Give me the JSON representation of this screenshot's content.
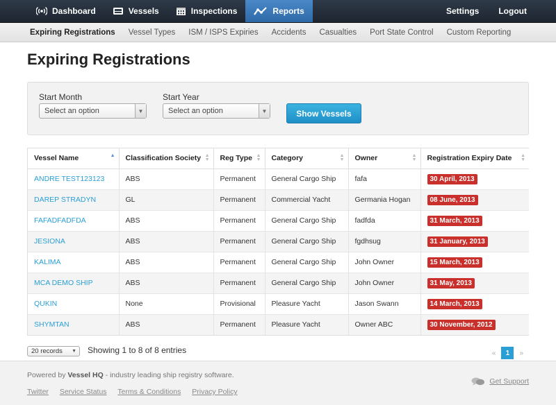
{
  "topnav": {
    "items": [
      {
        "label": "Dashboard",
        "icon": "wireless-icon"
      },
      {
        "label": "Vessels",
        "icon": "vessel-icon"
      },
      {
        "label": "Inspections",
        "icon": "calendar-icon"
      },
      {
        "label": "Reports",
        "icon": "chart-icon",
        "active": true
      }
    ],
    "settings": "Settings",
    "logout": "Logout"
  },
  "subnav": {
    "items": [
      "Expiring Registrations",
      "Vessel Types",
      "ISM / ISPS Expiries",
      "Accidents",
      "Casualties",
      "Port State Control",
      "Custom Reporting"
    ]
  },
  "page": {
    "title": "Expiring Registrations"
  },
  "filter": {
    "start_month_label": "Start Month",
    "start_month_value": "Select an option",
    "start_year_label": "Start Year",
    "start_year_value": "Select an option",
    "show_button": "Show Vessels"
  },
  "table": {
    "columns": [
      "Vessel Name",
      "Classification Society",
      "Reg Type",
      "Category",
      "Owner",
      "Registration Expiry Date"
    ],
    "rows": [
      [
        "ANDRE TEST123123",
        "ABS",
        "Permanent",
        "General Cargo Ship",
        "fafa",
        "30 April, 2013"
      ],
      [
        "DAREP STRADYN",
        "GL",
        "Permanent",
        "Commercial Yacht",
        "Germania Hogan",
        "08 June, 2013"
      ],
      [
        "FAFADFADFDA",
        "ABS",
        "Permanent",
        "General Cargo Ship",
        "fadfda",
        "31 March, 2013"
      ],
      [
        "JESIONA",
        "ABS",
        "Permanent",
        "General Cargo Ship",
        "fgdhsug",
        "31 January, 2013"
      ],
      [
        "KALIMA",
        "ABS",
        "Permanent",
        "General Cargo Ship",
        "John Owner",
        "15 March, 2013"
      ],
      [
        "MCA DEMO SHIP",
        "ABS",
        "Permanent",
        "General Cargo Ship",
        "John Owner",
        "31 May, 2013"
      ],
      [
        "QUKIN",
        "None",
        "Provisional",
        "Pleasure Yacht",
        "Jason Swann",
        "14 March, 2013"
      ],
      [
        "SHYMTAN",
        "ABS",
        "Permanent",
        "Pleasure Yacht",
        "Owner ABC",
        "30 November, 2012"
      ]
    ],
    "badge_color": "#c9302c",
    "link_color": "#2a9fd6"
  },
  "table_footer": {
    "length_value": "20 records",
    "info": "Showing 1 to 8 of 8 entries",
    "prev": "«",
    "current_page": "1",
    "next": "»"
  },
  "footer": {
    "powered_prefix": "Powered by ",
    "powered_brand": "Vessel HQ",
    "powered_suffix": " - industry leading ship registry software.",
    "links": [
      "Twitter",
      "Service Status",
      "Terms & Conditions",
      "Privacy Policy"
    ],
    "support": "Get Support"
  }
}
